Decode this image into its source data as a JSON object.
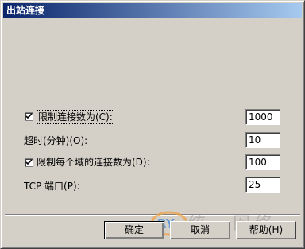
{
  "window": {
    "title": "出站连接"
  },
  "form": {
    "limit_connections": {
      "checked": true,
      "label": "限制连接数为(C):",
      "value": "1000"
    },
    "timeout": {
      "label": "超时(分钟)(O):",
      "value": "10"
    },
    "limit_per_domain": {
      "checked": true,
      "label": "限制每个域的连接数为(D):",
      "value": "100"
    },
    "tcp_port": {
      "label": "TCP 端口(P):",
      "value": "25"
    }
  },
  "buttons": {
    "ok": "确定",
    "cancel": "取消",
    "help": "帮助(H)"
  },
  "watermark": {
    "text": "统一网络"
  },
  "colors": {
    "title_start": "#0a246a",
    "title_end": "#a6caf0",
    "dialog_bg": "#d4d0c8"
  }
}
